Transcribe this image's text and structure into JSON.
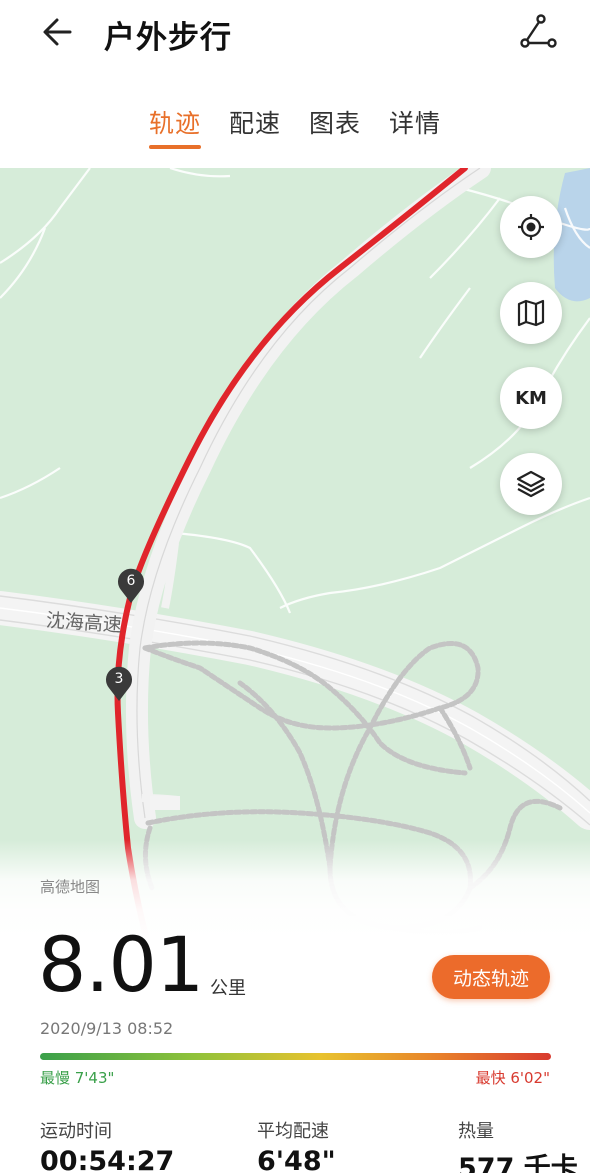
{
  "header": {
    "title": "户外步行",
    "back_icon": "arrow-left-icon",
    "share_icon": "share-icon"
  },
  "tabs": [
    {
      "label": "轨迹",
      "active": true
    },
    {
      "label": "配速",
      "active": false
    },
    {
      "label": "图表",
      "active": false
    },
    {
      "label": "详情",
      "active": false
    }
  ],
  "map": {
    "road_label": "沈海高速",
    "provider": "高德地图",
    "controls": [
      {
        "icon": "locate-icon"
      },
      {
        "icon": "map-icon"
      },
      {
        "label": "KM",
        "icon": "km-marker-icon"
      },
      {
        "icon": "layers-icon"
      }
    ],
    "km_markers": [
      "6",
      "3"
    ],
    "route_color": "#e0252b"
  },
  "summary": {
    "distance": "8.01",
    "distance_unit": "公里",
    "replay_button": "动态轨迹",
    "date": "2020/9/13 08:52",
    "pace_slowest": "最慢 7'43\"",
    "pace_fastest": "最快 6'02\""
  },
  "stats": [
    {
      "label": "运动时间",
      "value": "00:54:27"
    },
    {
      "label": "平均配速",
      "value": "6'48\""
    },
    {
      "label": "热量",
      "value": "577 千卡"
    }
  ],
  "colors": {
    "accent": "#e8702a",
    "map_background": "#d6ecd9",
    "pace_slow": "#3aa04a",
    "pace_fast": "#d83a2f"
  }
}
